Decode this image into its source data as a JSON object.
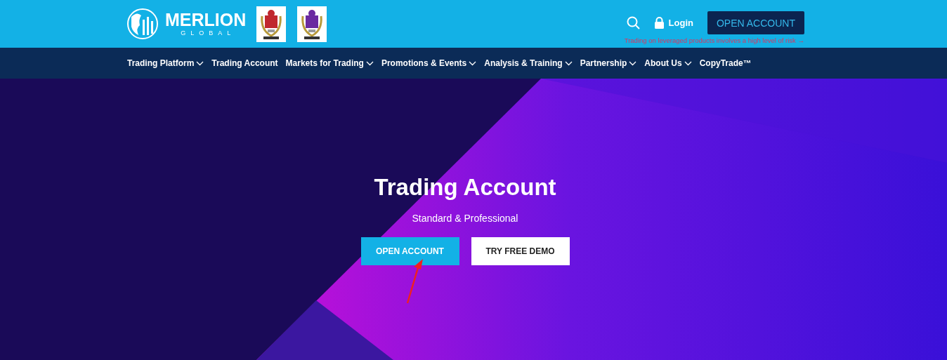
{
  "header": {
    "logo": {
      "name": "MERLION",
      "tagline": "GLOBAL"
    },
    "login": "Login",
    "open_account": "OPEN ACCOUNT",
    "risk_warning": "Trading on leveraged products involves a high level of risk →"
  },
  "nav": [
    {
      "label": "Trading Platform",
      "has_dropdown": true
    },
    {
      "label": "Trading Account",
      "has_dropdown": false
    },
    {
      "label": "Markets for Trading",
      "has_dropdown": true
    },
    {
      "label": "Promotions & Events",
      "has_dropdown": true
    },
    {
      "label": "Analysis & Training",
      "has_dropdown": true
    },
    {
      "label": "Partnership",
      "has_dropdown": true
    },
    {
      "label": "About Us",
      "has_dropdown": true
    },
    {
      "label": "CopyTrade™",
      "has_dropdown": false
    }
  ],
  "hero": {
    "title": "Trading Account",
    "subtitle": "Standard & Professional",
    "buttons": [
      {
        "label": "OPEN ACCOUNT",
        "kind": "primary"
      },
      {
        "label": "TRY FREE DEMO",
        "kind": "secondary"
      }
    ]
  }
}
